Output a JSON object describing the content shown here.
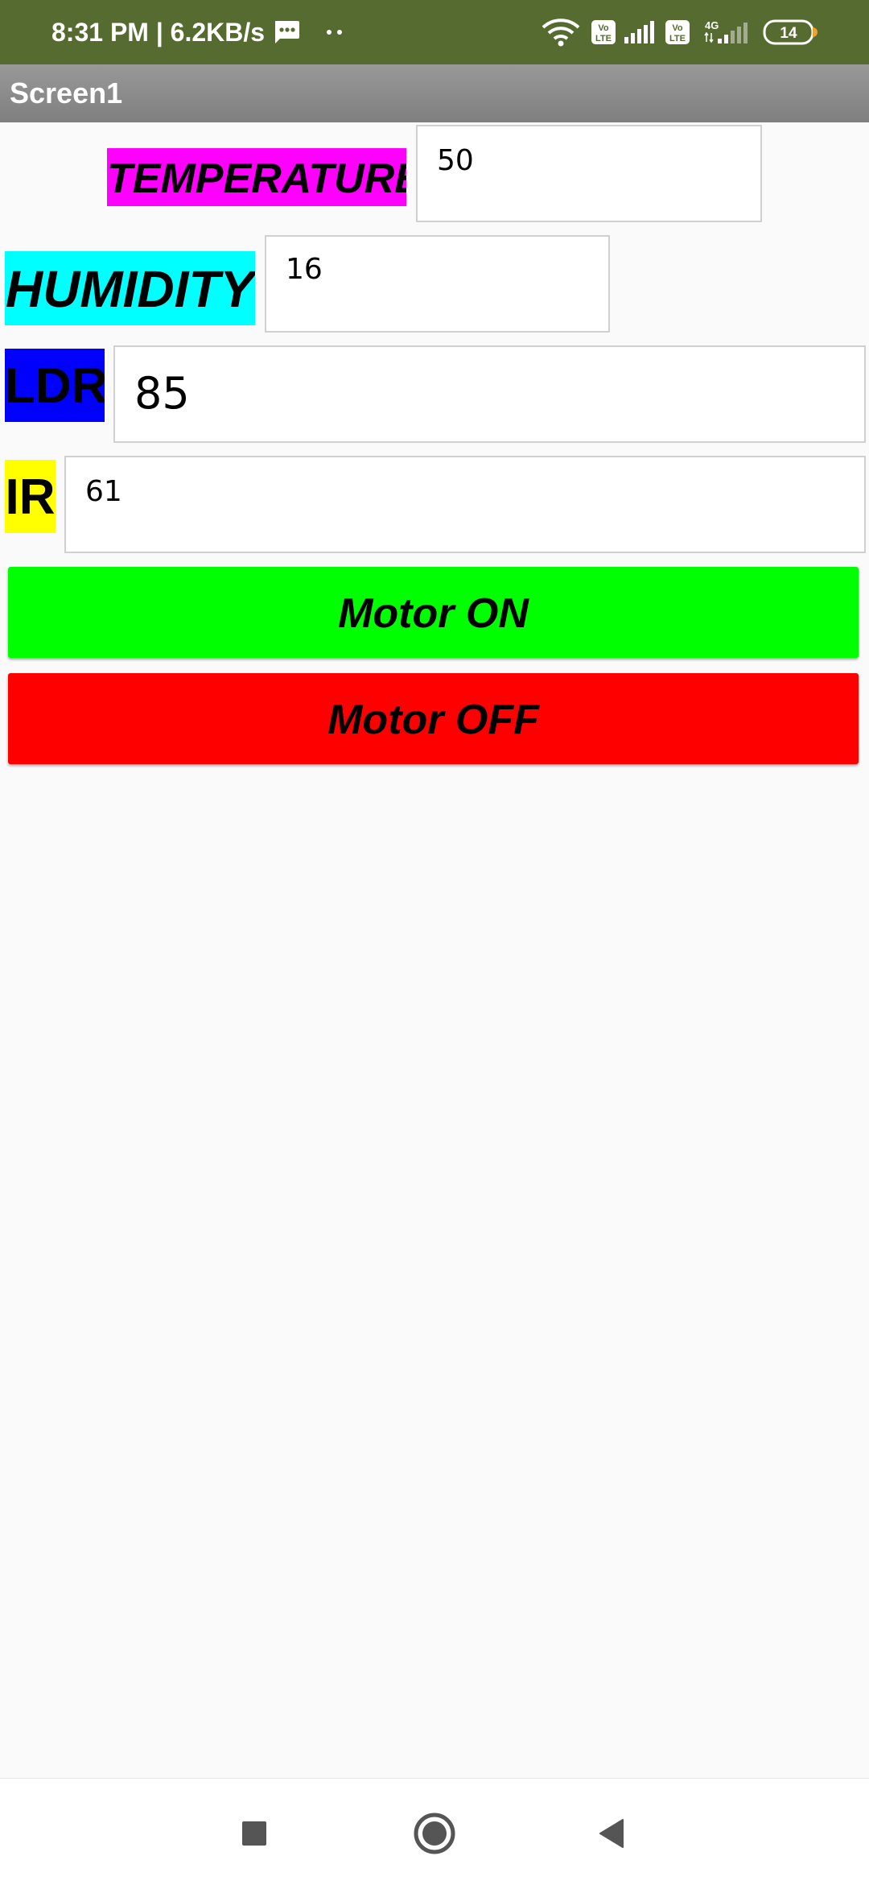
{
  "status_bar": {
    "time_speed": "8:31 PM | 6.2KB/s",
    "network_icons": [
      "message-icon",
      "more-dots-icon",
      "wifi-icon",
      "volte-icon",
      "signal-icon",
      "volte-icon",
      "4g-signal-icon"
    ],
    "lte_badge": "Vo\nLTE",
    "network_type": "4G",
    "battery_level": "14",
    "background": "#556b2f"
  },
  "title_bar": {
    "title": "Screen1"
  },
  "sensors": {
    "temperature": {
      "label": "TEMPERATURE",
      "value": "50",
      "label_color": "#ff00ff"
    },
    "humidity": {
      "label": "HUMIDITY",
      "value": "16",
      "label_color": "#00ffff"
    },
    "ldr": {
      "label": "LDR",
      "value": "85",
      "label_color": "#0000ff"
    },
    "ir": {
      "label": "IR",
      "value": "61",
      "label_color": "#ffff00"
    }
  },
  "buttons": {
    "motor_on": {
      "label": "Motor ON",
      "color": "#00ff00"
    },
    "motor_off": {
      "label": "Motor OFF",
      "color": "#ff0000"
    }
  },
  "nav_bar": {
    "icons": [
      "recents-square-icon",
      "home-circle-icon",
      "back-triangle-icon"
    ]
  }
}
